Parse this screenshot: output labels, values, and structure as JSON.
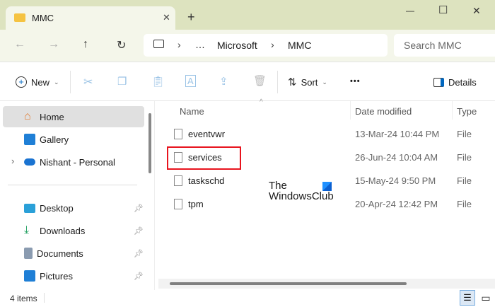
{
  "window": {
    "tab_title": "MMC",
    "new_tab": "+",
    "minimize": "—",
    "maximize": "☐",
    "close": "✕",
    "tab_close": "✕"
  },
  "nav": {
    "breadcrumb": [
      "…",
      "Microsoft",
      "MMC"
    ],
    "search_placeholder": "Search MMC"
  },
  "toolbar": {
    "new_label": "New",
    "sort_label": "Sort",
    "more": "•••",
    "details_label": "Details"
  },
  "sidebar": {
    "items": [
      {
        "label": "Home",
        "icon": "home-icon"
      },
      {
        "label": "Gallery",
        "icon": "gallery-icon"
      },
      {
        "label": "Nishant - Personal",
        "icon": "onedrive-icon"
      }
    ],
    "pinned": [
      {
        "label": "Desktop",
        "icon": "desktop-icon"
      },
      {
        "label": "Downloads",
        "icon": "downloads-icon"
      },
      {
        "label": "Documents",
        "icon": "documents-icon"
      },
      {
        "label": "Pictures",
        "icon": "pictures-icon"
      }
    ]
  },
  "columns": {
    "name": "Name",
    "date": "Date modified",
    "type": "Type"
  },
  "files": [
    {
      "name": "eventvwr",
      "date": "13-Mar-24 10:44 PM",
      "type": "File"
    },
    {
      "name": "services",
      "date": "26-Jun-24 10:04 AM",
      "type": "File",
      "highlighted": true
    },
    {
      "name": "taskschd",
      "date": "15-May-24 9:50 PM",
      "type": "File"
    },
    {
      "name": "tpm",
      "date": "20-Apr-24 12:42 PM",
      "type": "File"
    }
  ],
  "watermark": {
    "line1": "The",
    "line2": "WindowsClub"
  },
  "status": {
    "items": "4 items"
  },
  "colors": {
    "highlight": "#e8141e",
    "accent": "#0067c0",
    "titlebar": "#dde3bf"
  }
}
